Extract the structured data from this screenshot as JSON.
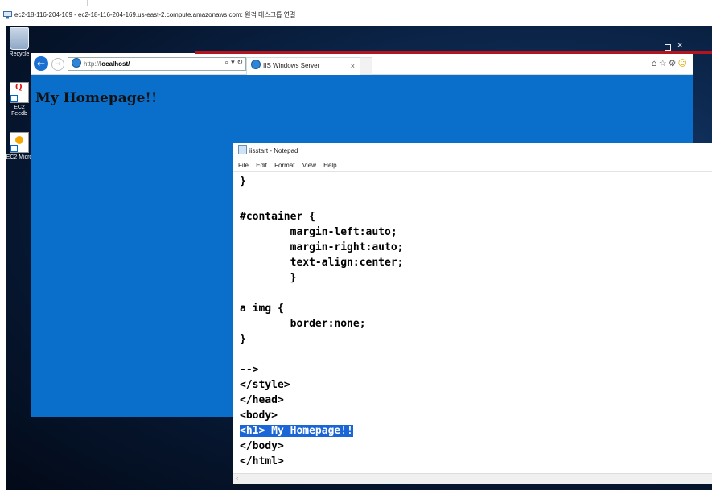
{
  "rdp": {
    "title": "ec2-18-116-204-169 - ec2-18-116-204-169.us-east-2.compute.amazonaws.com: 원격 데스크톱 연결"
  },
  "desktop": {
    "icons": [
      {
        "label": "Recycle",
        "icon": "recycle-bin-icon"
      },
      {
        "label": "EC2 Feedb",
        "icon": "ec2-feedback-icon"
      },
      {
        "label": "EC2 Micro",
        "icon": "ec2-microsoft-icon"
      }
    ]
  },
  "browser": {
    "url_prefix": "http://",
    "url_host": "localhost/",
    "address_tools": "⌕ ▾ ↻",
    "tab_title": "IIS Windows Server",
    "tab_close": "×",
    "toolbar_icons": [
      "home-icon",
      "favorites-star-icon",
      "settings-gear-icon",
      "smiley-feedback-icon"
    ],
    "page_heading": "My Homepage!!",
    "accent_color": "#0a6fcb"
  },
  "notepad": {
    "title": "iisstart - Notepad",
    "menu": [
      "File",
      "Edit",
      "Format",
      "View",
      "Help"
    ],
    "lines": [
      "}",
      "",
      "#container {",
      "        margin-left:auto;",
      "        margin-right:auto;",
      "        text-align:center;",
      "        }",
      "",
      "a img {",
      "        border:none;",
      "}",
      "",
      "-->",
      "</style>",
      "</head>",
      "<body>",
      "<h1> My Homepage!!",
      "</body>",
      "</html>"
    ],
    "selected_line": "<h1> My Homepage!!",
    "selection_color": "#1a66d6"
  }
}
